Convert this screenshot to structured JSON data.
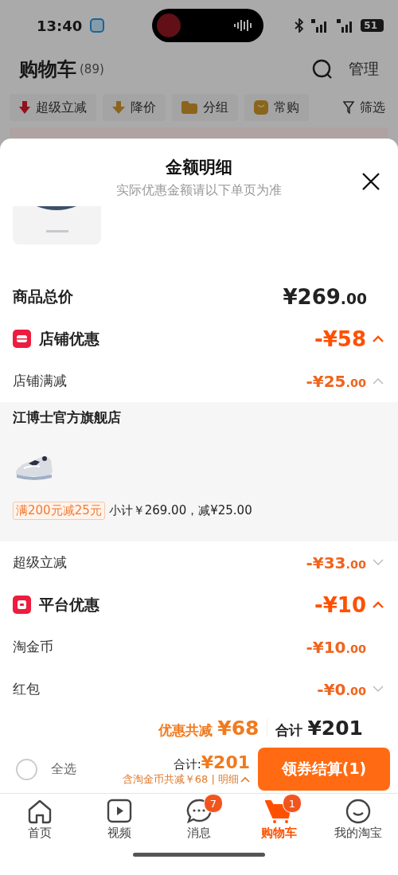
{
  "status_bar": {
    "time": "13:40",
    "battery": "51"
  },
  "header": {
    "title": "购物车",
    "count": "(89)",
    "manage": "管理"
  },
  "filters": [
    {
      "label": "超级立减"
    },
    {
      "label": "降价"
    },
    {
      "label": "分组"
    },
    {
      "label": "常购"
    },
    {
      "label": "筛选"
    }
  ],
  "sheet": {
    "title": "金额明细",
    "subtitle": "实际优惠金额请以下单页为准",
    "rows": [
      {
        "kind": "total",
        "label": "商品总价",
        "amount": "¥269.00"
      },
      {
        "kind": "group",
        "label": "店铺优惠",
        "amount": "-¥58",
        "expanded": true
      },
      {
        "kind": "item",
        "label": "店铺满减",
        "amount": "-¥25.00",
        "expanded": true
      },
      {
        "kind": "store",
        "name": "江博士官方旗舰店",
        "tag": "满200元减25元",
        "subtotal": "小计￥269.00，减¥25.00"
      },
      {
        "kind": "item",
        "label": "超级立减",
        "amount": "-¥33.00",
        "expanded": false
      },
      {
        "kind": "group",
        "label": "平台优惠",
        "amount": "-¥10",
        "expanded": true
      },
      {
        "kind": "item",
        "label": "淘金币",
        "amount": "-¥10.00"
      },
      {
        "kind": "item",
        "label": "红包",
        "amount": "-¥0.00",
        "expanded": false
      }
    ],
    "summary": {
      "discount_label": "优惠共减",
      "discount": "¥68",
      "total_label": "合计",
      "total": "¥201"
    }
  },
  "checkout": {
    "select_all": {
      "label": "全选",
      "checked": false
    },
    "total_label": "合计:",
    "total": "¥201",
    "note": "含淘金币共减￥68 | 明细",
    "button": "领券结算(1)"
  },
  "tabbar": [
    {
      "label": "首页",
      "selected": false
    },
    {
      "label": "视频",
      "selected": false
    },
    {
      "label": "消息",
      "badge": "7",
      "selected": false
    },
    {
      "label": "购物车",
      "badge": "1",
      "selected": true
    },
    {
      "label": "我的淘宝",
      "selected": false
    }
  ]
}
